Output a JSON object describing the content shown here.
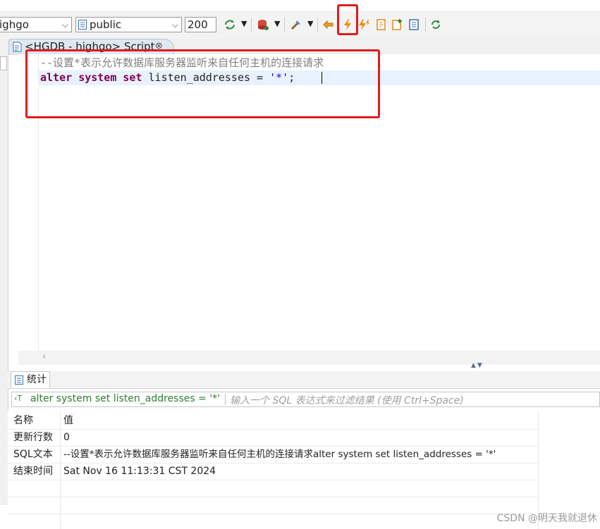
{
  "toolbar": {
    "database_combo": "ighgo",
    "schema_combo": "public",
    "max_rows": "200",
    "icons": [
      "refresh-schema-icon",
      "commit-icon",
      "tools-icon",
      "back-icon",
      "execute-statement-icon",
      "execute-script-icon",
      "explain-icon",
      "new-script-icon",
      "format-icon",
      "refresh-icon"
    ]
  },
  "editor": {
    "tab_label": "<HGDB - highgo> Script",
    "comment_line": "--设置*表示允许数据库服务器监听来自任何主机的连接请求",
    "code_kw1": "alter",
    "code_kw2": "system",
    "code_kw3": "set",
    "code_ident": "listen_addresses = ",
    "code_string": "'*'",
    "code_end": ";"
  },
  "results": {
    "tab_label": "统计",
    "filter_query": "alter system set listen_addresses = '*'",
    "filter_placeholder": "输入一个 SQL 表达式来过滤结果 (使用 Ctrl+Space)",
    "columns": [
      "名称",
      "值"
    ],
    "rows": [
      {
        "name": "更新行数",
        "value": "0"
      },
      {
        "name": "SQL文本",
        "value": "--设置*表示允许数据库服务器监听来自任何主机的连接请求alter system set listen_addresses = '*'"
      },
      {
        "name": "结束时间",
        "value": "Sat Nov 16 11:13:31 CST 2024"
      }
    ]
  },
  "watermark": "CSDN @明天我就退休",
  "colors": {
    "highlight": "#e21b1b",
    "keyword": "#7f0055",
    "string": "#2a00ff",
    "comment": "#808080"
  }
}
